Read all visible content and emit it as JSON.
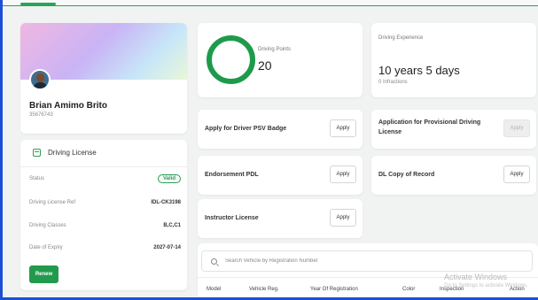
{
  "profile": {
    "name": "Brian Amimo Brito",
    "id_number": "35676743"
  },
  "license": {
    "title": "Driving License",
    "rows": [
      {
        "label": "Status",
        "value": "Valid"
      },
      {
        "label": "Driving License Ref",
        "value": "IDL-CK3198"
      },
      {
        "label": "Driving Classes",
        "value": "B,C,C1"
      },
      {
        "label": "Date of Expiry",
        "value": "2027-07-14"
      }
    ],
    "renew_label": "Renew"
  },
  "points": {
    "label": "Driving Points",
    "value": "20"
  },
  "experience": {
    "label": "Driving Experience",
    "value": "10 years 5 days",
    "infractions": "0 Infractions"
  },
  "actions": {
    "psv_badge": {
      "label": "Apply for Driver PSV Badge",
      "button": "Apply"
    },
    "provisional": {
      "label": "Application for Provisional Driving License",
      "button": "Apply"
    },
    "endorsement": {
      "label": "Endorsement PDL",
      "button": "Apply"
    },
    "dl_copy": {
      "label": "DL Copy of Record",
      "button": "Apply"
    },
    "instructor": {
      "label": "Instructor License",
      "button": "Apply"
    }
  },
  "vehicles": {
    "search_placeholder": "Search Vehicle by Registration Number",
    "columns": [
      "Model",
      "Vehicle Reg.",
      "Year Of Registration",
      "Color",
      "Inspection",
      "Action"
    ]
  },
  "watermark": {
    "title": "Activate Windows",
    "subtitle": "Go to Settings to activate Windows."
  },
  "colors": {
    "accent_green": "#229a4d",
    "frame_blue": "#1c4fd6"
  }
}
